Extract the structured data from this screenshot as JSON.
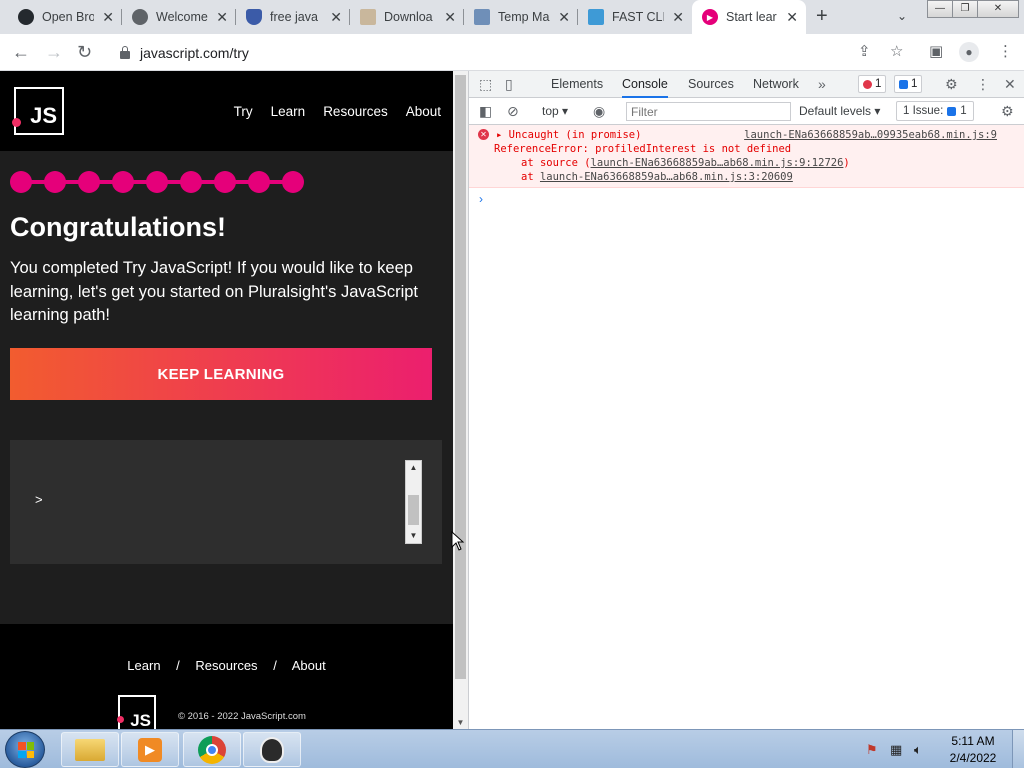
{
  "browser": {
    "tabs": [
      {
        "title": "Open Bro",
        "icon": "github-icon",
        "color": "#24292e"
      },
      {
        "title": "Welcome",
        "icon": "globe-icon",
        "color": "#5f6368"
      },
      {
        "title": "free java",
        "icon": "shield-icon",
        "color": "#3b5ba8"
      },
      {
        "title": "Downloa",
        "icon": "document-icon",
        "color": "#8d6e4a"
      },
      {
        "title": "Temp Ma",
        "icon": "mail-icon",
        "color": "#6f8fb8"
      },
      {
        "title": "FAST CLI",
        "icon": "fast-click-icon",
        "color": "#3e9ad6"
      },
      {
        "title": "Start lear",
        "icon": "pluralsight-icon",
        "color": "#e5007a"
      }
    ],
    "new_tab": "+",
    "tab_search": "⌄",
    "window_controls": {
      "minimize": "—",
      "maximize": "❐",
      "close": "✕"
    },
    "nav": {
      "back": "←",
      "forward": "→",
      "reload": "↻"
    },
    "url": "javascript.com/try"
  },
  "site": {
    "logo_text": "JS",
    "nav": [
      "Try",
      "Learn",
      "Resources",
      "About"
    ],
    "progress": {
      "completed_steps": 9,
      "total_steps": 9
    },
    "heading": "Congratulations!",
    "message": "You completed Try JavaScript! If you would like to keep learning, let's get you started on Pluralsight's JavaScript learning path!",
    "cta": "KEEP LEARNING",
    "repl_prompt": ">",
    "footer_nav": [
      "Learn",
      "Resources",
      "About"
    ],
    "footer_separator": "/",
    "copyright": "© 2016 - 2022 JavaScript.com",
    "accent_color": "#e5007a"
  },
  "devtools": {
    "tabs": [
      "Elements",
      "Console",
      "Sources",
      "Network"
    ],
    "active_tab": "Console",
    "more_tabs": "»",
    "error_count": "1",
    "message_count": "1",
    "context": "top",
    "filter_placeholder": "Filter",
    "levels": "Default levels",
    "issues_label": "1 Issue:",
    "issues_count": "1",
    "error": {
      "line1": "Uncaught (in promise)",
      "source": "launch-ENa63668859ab…09935eab68.min.js:9",
      "line2": "ReferenceError: profiledInterest is not defined",
      "line3_prefix": "at source (",
      "line3_link": "launch-ENa63668859ab…ab68.min.js:9:12726",
      "line3_suffix": ")",
      "line4_prefix": "at ",
      "line4_link": "launch-ENa63668859ab…ab68.min.js:3:20609"
    },
    "prompt": "›"
  },
  "taskbar": {
    "apps": [
      "file-explorer-icon",
      "media-player-icon",
      "chrome-icon",
      "penguin-app-icon"
    ],
    "time": "5:11 AM",
    "date": "2/4/2022"
  }
}
